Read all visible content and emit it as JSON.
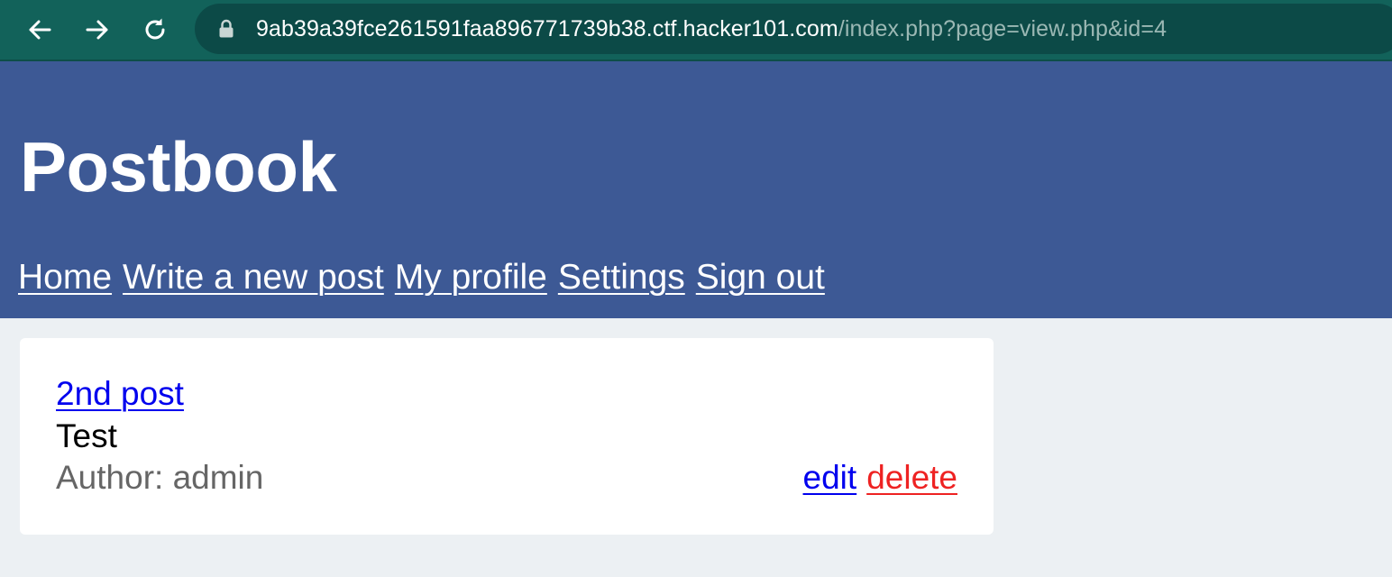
{
  "browser": {
    "url_host": "9ab39a39fce261591faa896771739b38.ctf.hacker101.com",
    "url_path": "/index.php?page=view.php&id=4",
    "icons": [
      "back-arrow-icon",
      "forward-arrow-icon",
      "reload-icon",
      "lock-icon"
    ],
    "colors": {
      "toolbar": "#12625a",
      "omnibox": "#0c4a47"
    }
  },
  "site": {
    "title": "Postbook",
    "header_color": "#3d5995",
    "nav": [
      {
        "label": "Home"
      },
      {
        "label": "Write a new post"
      },
      {
        "label": "My profile"
      },
      {
        "label": "Settings"
      },
      {
        "label": "Sign out"
      }
    ]
  },
  "post": {
    "title": "2nd post",
    "body": "Test",
    "author": "Author: admin",
    "actions": {
      "edit": "edit",
      "delete": "delete"
    },
    "colors": {
      "link": "#0000ee",
      "delete": "#ee2222",
      "author": "#666666"
    }
  }
}
